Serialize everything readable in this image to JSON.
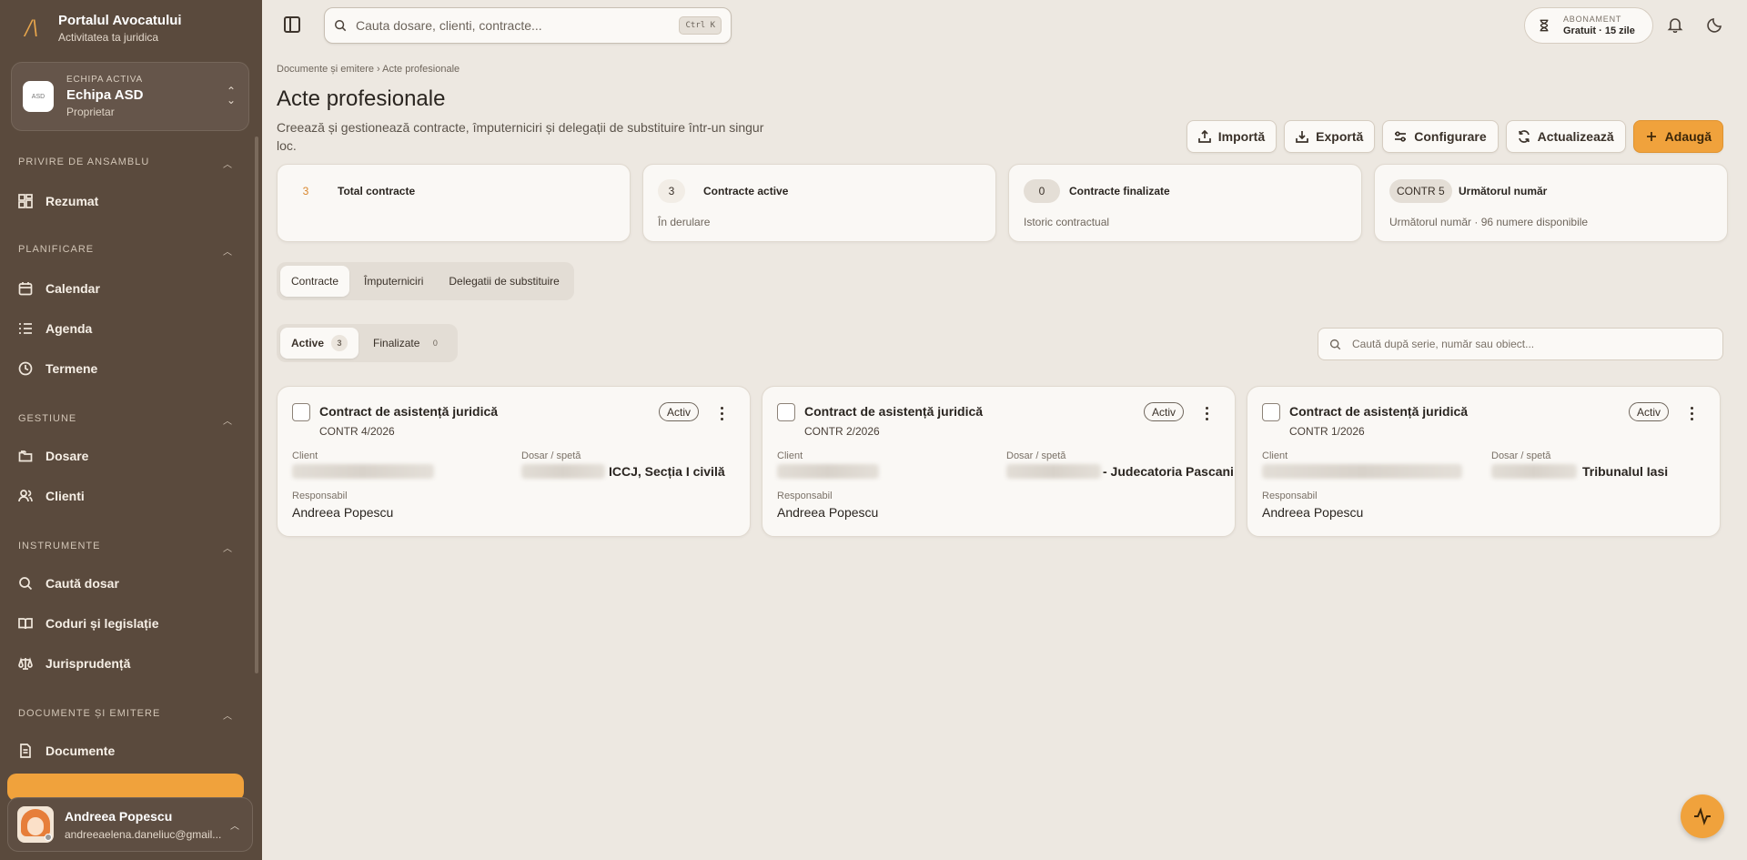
{
  "app": {
    "title": "Portalul Avocatului",
    "subtitle": "Activitatea ta juridica"
  },
  "team": {
    "tag": "ECHIPA ACTIVA",
    "name": "Echipa ASD",
    "role": "Proprietar"
  },
  "sidebar": {
    "sections": [
      {
        "title": "PRIVIRE DE ANSAMBLU",
        "items": [
          {
            "label": "Rezumat",
            "icon": "grid-icon"
          }
        ]
      },
      {
        "title": "PLANIFICARE",
        "items": [
          {
            "label": "Calendar",
            "icon": "calendar-icon"
          },
          {
            "label": "Agenda",
            "icon": "list-icon"
          },
          {
            "label": "Termene",
            "icon": "clock-icon"
          }
        ]
      },
      {
        "title": "GESTIUNE",
        "items": [
          {
            "label": "Dosare",
            "icon": "folder-icon"
          },
          {
            "label": "Clienti",
            "icon": "users-icon"
          }
        ]
      },
      {
        "title": "INSTRUMENTE",
        "items": [
          {
            "label": "Caută dosar",
            "icon": "search-icon"
          },
          {
            "label": "Coduri și legislație",
            "icon": "book-icon"
          },
          {
            "label": "Jurisprudență",
            "icon": "scale-icon"
          }
        ]
      },
      {
        "title": "DOCUMENTE ȘI EMITERE",
        "items": [
          {
            "label": "Documente",
            "icon": "document-icon"
          }
        ]
      }
    ]
  },
  "user": {
    "name": "Andreea Popescu",
    "email": "andreeaelena.daneliuc@gmail..."
  },
  "topbar": {
    "search_placeholder": "Cauta dosare, clienti, contracte...",
    "shortcut": "Ctrl K",
    "subscription_tag": "ABONAMENT",
    "subscription_value": "Gratuit · 15 zile"
  },
  "page": {
    "breadcrumb": "Documente și emitere › Acte profesionale",
    "title": "Acte profesionale",
    "description": "Creează și gestionează contracte, împuterniciri și delegații de substituire într-un singur loc."
  },
  "actions": {
    "import": "Importă",
    "export": "Exportă",
    "configure": "Configurare",
    "refresh": "Actualizează",
    "add": "Adaugă"
  },
  "stats": [
    {
      "value": "3",
      "label": "Total contracte",
      "sub": ""
    },
    {
      "value": "3",
      "label": "Contracte active",
      "sub": "În derulare"
    },
    {
      "value": "0",
      "label": "Contracte finalizate",
      "sub": "Istoric contractual"
    },
    {
      "value": "CONTR 5",
      "label": "Următorul număr",
      "sub": "Următorul număr · 96 numere disponibile"
    }
  ],
  "tabs": [
    "Contracte",
    "Împuterniciri",
    "Delegatii de substituire"
  ],
  "subtabs": [
    {
      "label": "Active",
      "count": "3"
    },
    {
      "label": "Finalizate",
      "count": "0"
    }
  ],
  "list_search_placeholder": "Caută după serie, număr sau obiect...",
  "card_labels": {
    "client": "Client",
    "case": "Dosar / spetă",
    "responsible": "Responsabil"
  },
  "cards": [
    {
      "title": "Contract de asistență juridică",
      "number": "CONTR 4/2026",
      "status": "Activ",
      "case_visible": "ICCJ, Secția I civilă",
      "responsible": "Andreea Popescu"
    },
    {
      "title": "Contract de asistență juridică",
      "number": "CONTR 2/2026",
      "status": "Activ",
      "case_visible": "- Judecatoria Pascani",
      "responsible": "Andreea Popescu"
    },
    {
      "title": "Contract de asistență juridică",
      "number": "CONTR 1/2026",
      "status": "Activ",
      "case_visible": "Tribunalul Iasi",
      "responsible": "Andreea Popescu"
    }
  ],
  "colors": {
    "accent": "#f0a23c",
    "sidebar": "#5a4a3d",
    "background": "#ede8e1"
  }
}
